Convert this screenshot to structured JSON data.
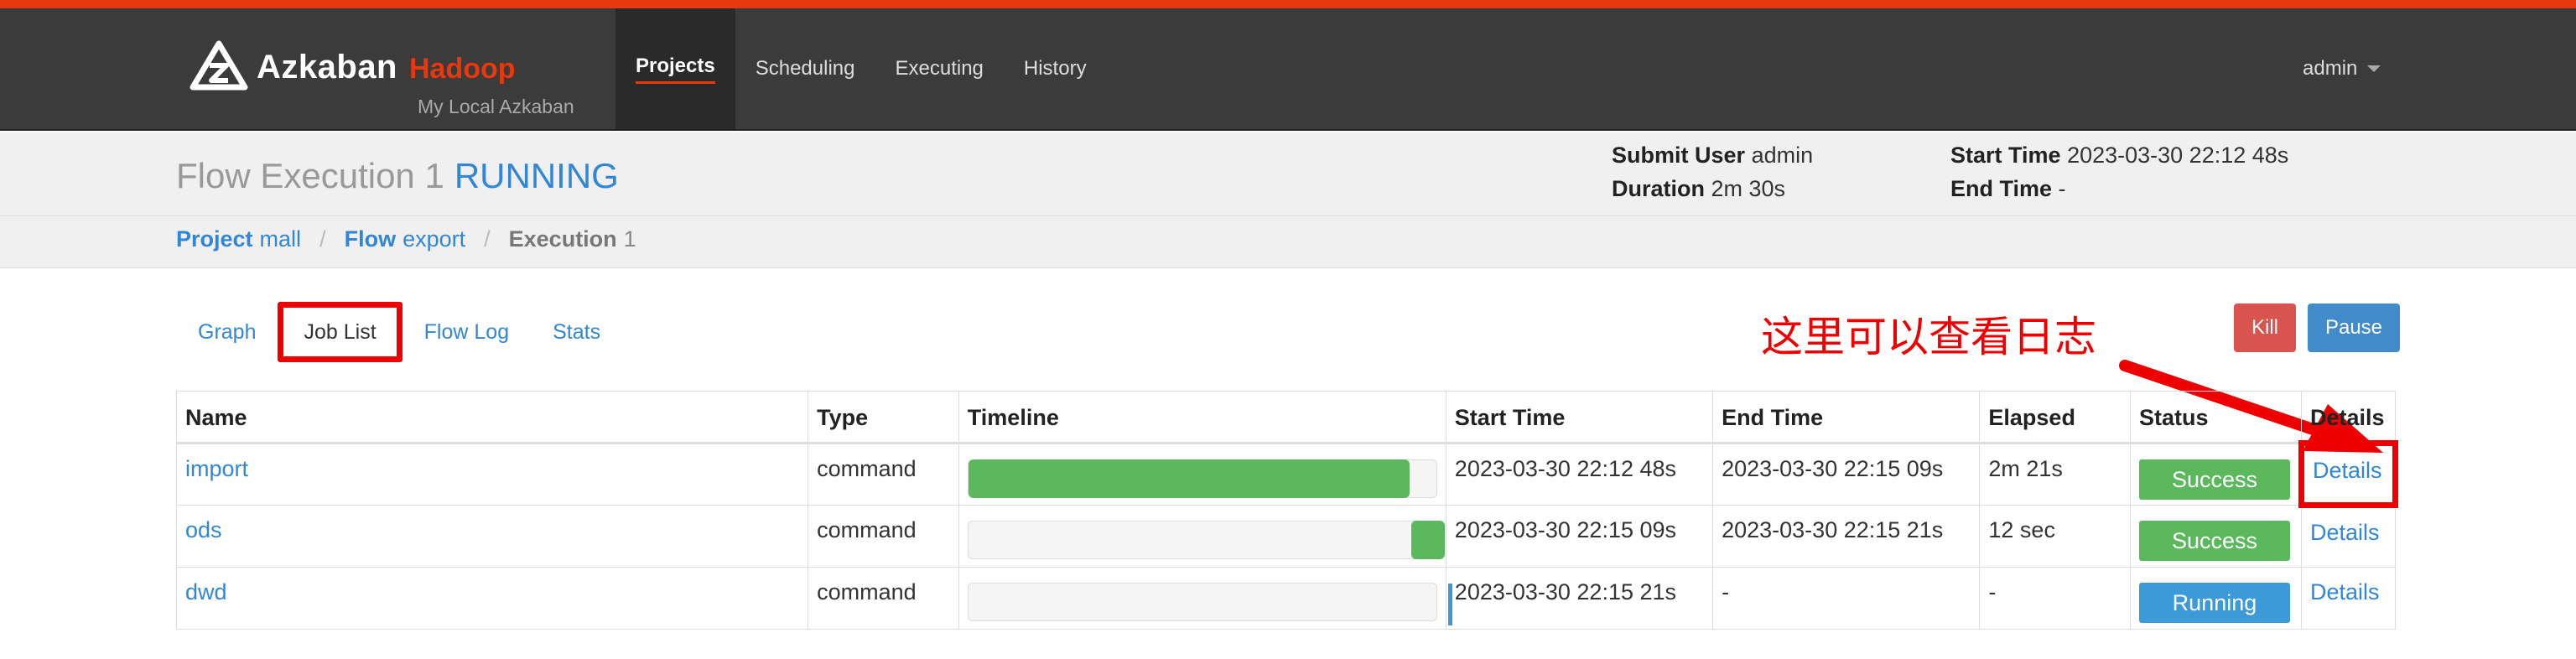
{
  "navbar": {
    "brand": "Azkaban",
    "brand_sub": "Hadoop",
    "brand_tagline": "My Local Azkaban",
    "items": [
      {
        "label": "Projects",
        "active": true
      },
      {
        "label": "Scheduling"
      },
      {
        "label": "Executing"
      },
      {
        "label": "History"
      }
    ],
    "user": "admin"
  },
  "header": {
    "title": "Flow Execution 1",
    "status": "RUNNING",
    "submit_user_label": "Submit User",
    "submit_user": "admin",
    "duration_label": "Duration",
    "duration": "2m 30s",
    "start_time_label": "Start Time",
    "start_time": "2023-03-30 22:12 48s",
    "end_time_label": "End Time",
    "end_time": "-"
  },
  "breadcrumb": {
    "project_label": "Project",
    "project": "mall",
    "flow_label": "Flow",
    "flow": "export",
    "execution_label": "Execution",
    "execution": "1"
  },
  "tabs": [
    "Graph",
    "Job List",
    "Flow Log",
    "Stats"
  ],
  "actions": {
    "kill": "Kill",
    "pause": "Pause"
  },
  "annotation": "这里可以查看日志",
  "table": {
    "columns": [
      "Name",
      "Type",
      "Timeline",
      "Start Time",
      "End Time",
      "Elapsed",
      "Status",
      "Details"
    ],
    "rows": [
      {
        "name": "import",
        "type": "command",
        "timeline_start": 0.0,
        "timeline_end": 0.94,
        "start": "2023-03-30 22:12 48s",
        "end": "2023-03-30 22:15 09s",
        "elapsed": "2m 21s",
        "status": "Success",
        "details": "Details"
      },
      {
        "name": "ods",
        "type": "command",
        "timeline_start": 0.94,
        "timeline_end": 1.0,
        "start": "2023-03-30 22:15 09s",
        "end": "2023-03-30 22:15 21s",
        "elapsed": "12 sec",
        "status": "Success",
        "details": "Details"
      },
      {
        "name": "dwd",
        "type": "command",
        "timeline_start": 1.0,
        "timeline_end": 1.0,
        "start": "2023-03-30 22:15 21s",
        "end": "-",
        "elapsed": "-",
        "status": "Running",
        "details": "Details"
      }
    ]
  },
  "colors": {
    "accent": "#e8380d",
    "link": "#3187d6",
    "success": "#5cb85c",
    "running": "#3d9ad8",
    "annotation": "#ee0000"
  }
}
